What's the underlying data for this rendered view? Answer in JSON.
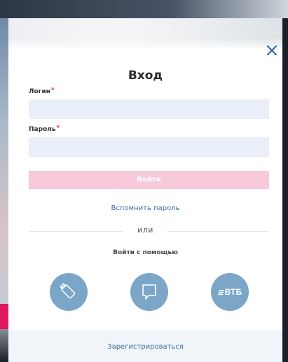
{
  "modal": {
    "title": "Вход",
    "close_icon": "close-icon",
    "login": {
      "label": "Логин",
      "required_mark": "*",
      "value": "",
      "placeholder": ""
    },
    "password": {
      "label": "Пароль",
      "required_mark": "*",
      "value": "",
      "placeholder": ""
    },
    "submit_label": "Войти",
    "forgot_link": "Вспомнить пароль",
    "divider_text": "или",
    "via_text": "Войти с помощью",
    "social": [
      {
        "name": "usb-token",
        "icon": "usb-token-icon"
      },
      {
        "name": "chat",
        "icon": "chat-bubble-icon"
      },
      {
        "name": "vtb",
        "label": "ВТБ",
        "icon": "vtb-logo-icon"
      }
    ],
    "register_link": "Зарегистрироваться"
  },
  "colors": {
    "accent_pink": "#e0185f",
    "button_disabled": "#f7c9da",
    "input_bg": "#e9eef8",
    "link": "#3d6fa3",
    "social_bg": "#7ba6c8",
    "footer_bg": "#f1f4f9"
  }
}
